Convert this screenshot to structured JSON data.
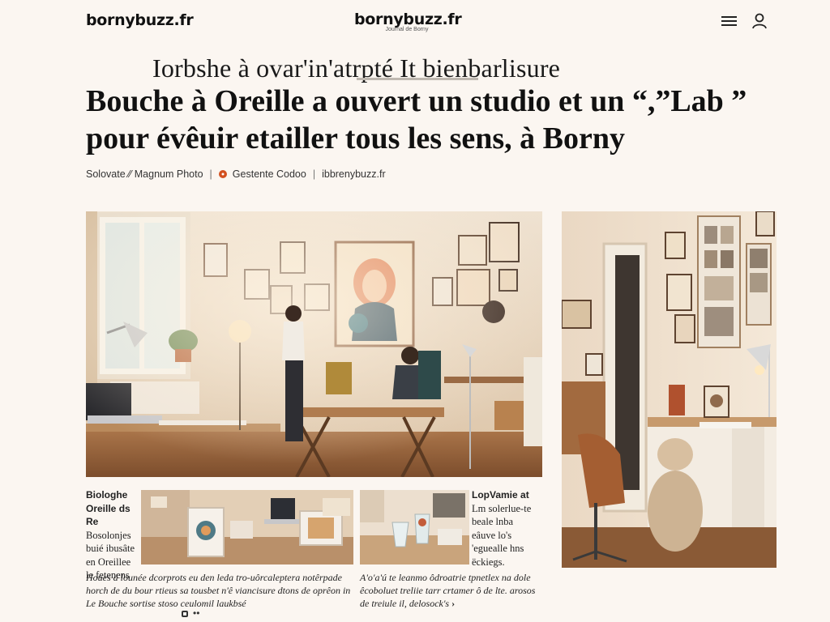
{
  "header": {
    "site_name_left": "bornybuzz.fr",
    "site_name_center": "bornybuzz.fr",
    "site_tagline": "Journal de Borny",
    "menu_icon": "hamburger-icon",
    "user_icon": "user-icon"
  },
  "article": {
    "kicker": "Iorbshe à ovar'in'atrpté It bienbarlisure",
    "headline": "Bouche à Oreille a ouvert un studio et un “,”Lab ” pour évêuir etailler tous les sens, à Borny",
    "byline": {
      "photo_credit": "Solovate ⁄⁄ Magnum Photo",
      "location": "Gestente Codoo",
      "source": "ibbrenybuzz.fr"
    }
  },
  "images": {
    "hero_alt": "Atelier lumineux avec tables, lampes et œuvres au mur",
    "side_alt": "Bureau avec chaise en cuir et lampe d'architecte",
    "thumb1_alt": "Table de travail avec dessins et ordinateur",
    "thumb2_alt": "Établi avec bocaux et outils"
  },
  "captions": {
    "left_title": "Biologhe Oreille ds Re",
    "left_lines": [
      "Bosolonjes",
      "buié ibusâte",
      "en Oreillee",
      "le fetenens"
    ],
    "right_title": "LopVamie at",
    "right_lines": [
      "Lm solerlue-te",
      "beale lnba",
      "eâuve lo's",
      "'eguealle hns",
      "ëckiegs."
    ]
  },
  "paragraphs": {
    "left": "Houes á lounée dcorprots eu den leda tro-uôrcaleptera notêrpade horch de du bour rtieus sa tousbet n'ê viancisure dtons de oprêon in Le Bouche sortise stoso ceulomil laukbsé",
    "right": "A'o'a'ú te leanmo ôdroatrie tpnetlex na dole êcoboluet treliie tarr crtamer ô de lte. arosos de treiule il, delosock's",
    "right_more": "›"
  },
  "colors": {
    "page_bg": "#fbf6f1",
    "text": "#111111",
    "pin_accent": "#d3501f"
  }
}
